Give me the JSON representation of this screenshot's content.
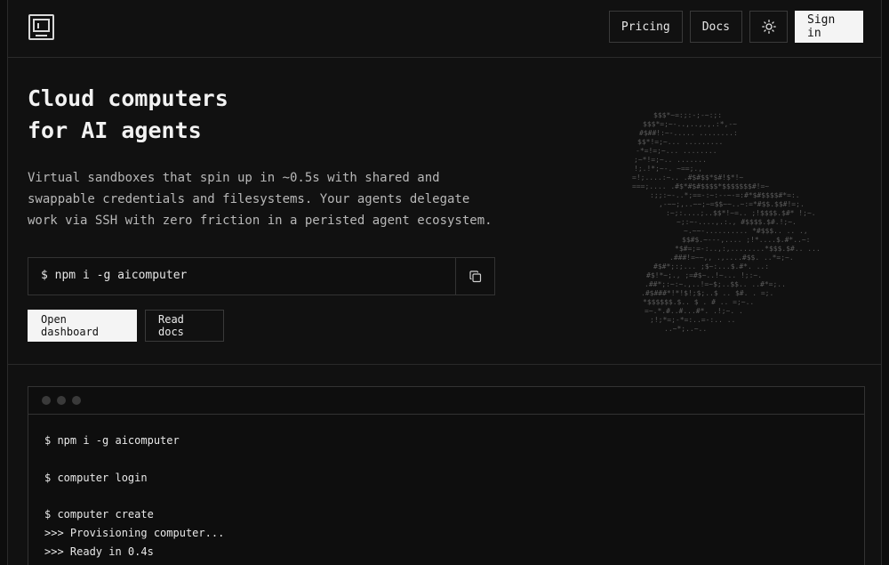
{
  "header": {
    "nav": {
      "pricing": "Pricing",
      "docs": "Docs",
      "sign_in": "Sign in"
    }
  },
  "hero": {
    "title_line1": "Cloud computers",
    "title_line2": "for AI agents",
    "subtitle_line1": "Virtual sandboxes that spin up in ~0.5s with shared and",
    "subtitle_line2": "swappable credentials and filesystems. Your agents delegate",
    "subtitle_line3": "work via SSH with zero friction in a peristed agent ecosystem.",
    "install_command": "$ npm i -g aicomputer",
    "open_dashboard": "Open dashboard",
    "read_docs": "Read docs"
  },
  "terminal": {
    "lines": [
      "$ npm i -g aicomputer",
      "$ computer login",
      "$ computer create",
      ">>> Provisioning computer...",
      ">>> Ready in 0.4s"
    ]
  },
  "colors": {
    "background": "#111111",
    "accent_button": "#f4f4f4",
    "border": "#2a2a2a"
  },
  "icons": {
    "logo": "terminal-window-icon",
    "theme": "sun-icon",
    "copy": "copy-icon"
  }
}
